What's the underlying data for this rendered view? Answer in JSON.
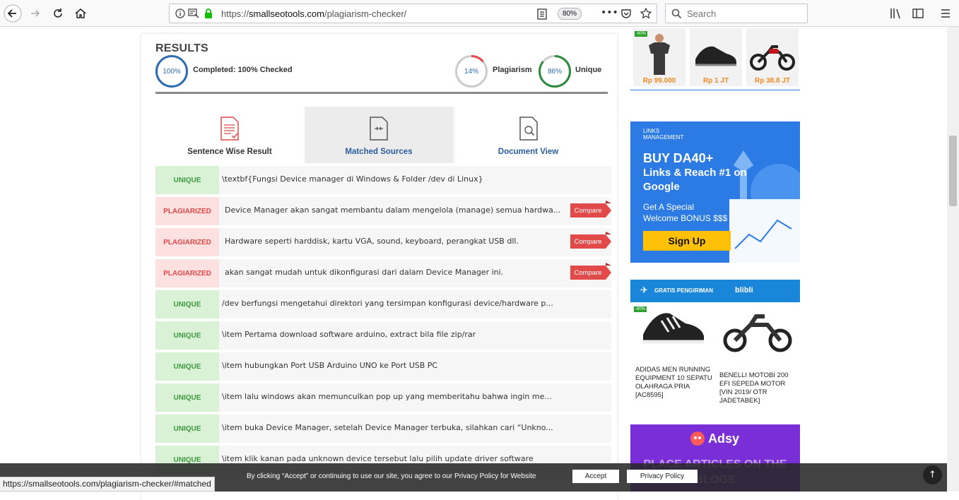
{
  "browser": {
    "url_prefix": "https://",
    "url_host": "smallseotools.com",
    "url_path": "/plagiarism-checker/",
    "zoom": "80%",
    "search_placeholder": "Search",
    "status_url": "https://smallseotools.com/plagiarism-checker/#matched"
  },
  "results": {
    "title": "RESULTS",
    "completed_percent": "100%",
    "completed_label": "Completed: 100% Checked",
    "plagiarism_percent": "14%",
    "plagiarism_label": "Plagiarism",
    "plagiarism_value": 14,
    "unique_percent": "86%",
    "unique_label": "Unique",
    "unique_value": 86,
    "colors": {
      "completed": "#2b6cb0",
      "plagiarism": "#e24a4a",
      "unique": "#2e8b3e"
    }
  },
  "tabs": [
    {
      "label": "Sentence Wise Result",
      "icon": "document-list-icon",
      "color": "#333333"
    },
    {
      "label": "Matched Sources",
      "icon": "document-compare-icon",
      "color": "#2a5d9f"
    },
    {
      "label": "Document View",
      "icon": "document-search-icon",
      "color": "#2a5d9f"
    }
  ],
  "rows": [
    {
      "status": "UNIQUE",
      "text": "\\textbf{Fungsi Device manager di Windows & Folder /dev di Linux}"
    },
    {
      "status": "PLAGIARIZED",
      "text": "Device Manager akan sangat membantu dalam mengelola (manage) semua hardwa...",
      "compare": "Compare"
    },
    {
      "status": "PLAGIARIZED",
      "text": "Hardware seperti harddisk, kartu VGA, sound, keyboard, perangkat USB dll.",
      "compare": "Compare"
    },
    {
      "status": "PLAGIARIZED",
      "text": "akan sangat mudah untuk dikonfigurasi dari dalam Device Manager ini.",
      "compare": "Compare"
    },
    {
      "status": "UNIQUE",
      "text": "/dev berfungsi mengetahui direktori yang tersimpan konfigurasi device/hardware p..."
    },
    {
      "status": "UNIQUE",
      "text": "\\item Pertama download software arduino, extract bila file zip/rar"
    },
    {
      "status": "UNIQUE",
      "text": "\\item hubungkan Port USB Arduino UNO ke Port USB PC"
    },
    {
      "status": "UNIQUE",
      "text": "\\item lalu windows akan memunculkan pop up yang memberitahu bahwa ingin me..."
    },
    {
      "status": "UNIQUE",
      "text": "\\item buka Device Manager, setelah Device Manager terbuka, silahkan cari “Unkno..."
    },
    {
      "status": "UNIQUE",
      "text": "\\item klik kanan pada unknown device tersebut lalu pilih update driver software"
    }
  ],
  "ads": {
    "products": [
      {
        "price": "Rp 99.000",
        "badge": "-60%"
      },
      {
        "price": "Rp 1 JT"
      },
      {
        "price": "Rp 38.8 JT"
      }
    ],
    "links": {
      "brand_line1": "LINKS",
      "brand_line2": "MANAGEMENT",
      "headline1": "BUY DA40+",
      "headline2": "Links & Reach #1 on",
      "headline3": "Google",
      "sub1": "Get A Special",
      "sub2": "Welcome BONUS $$$",
      "cta": "Sign Up"
    },
    "blibli": {
      "banner": "GRATIS PENGIRIMAN",
      "brand": "blibli",
      "badge": "-60%",
      "item1": "ADIDAS MEN RUNNING EQUIPMENT 10 SEPATU OLAHRAGA PRIA [AC8595]",
      "item2": "BENELLI MOTOBI 200 EFI SEPEDA MOTOR [VIN 2019/ OTR JADETABEK]"
    },
    "adsy": {
      "brand": "Adsy",
      "headline": "PLACE ARTICLES ON THE BLOGS"
    }
  },
  "cookie": {
    "text": "By clicking “Accept” or continuing to use our site, you agree to our Privacy Policy for Website",
    "accept": "Accept",
    "privacy": "Privacy Policy"
  }
}
